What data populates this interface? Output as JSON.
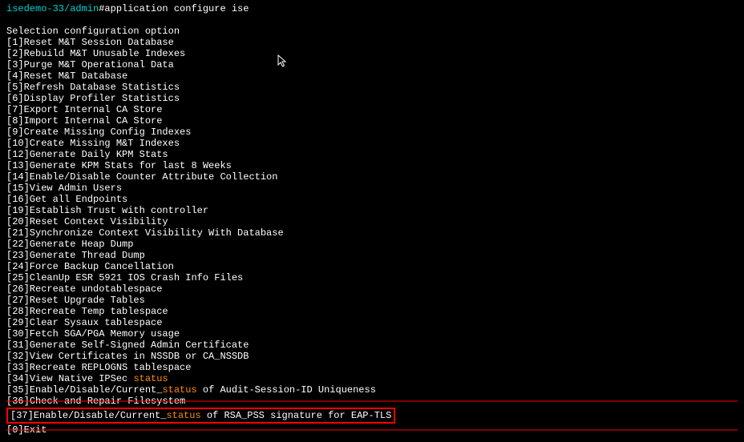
{
  "prompt": {
    "prefix": "isedemo-33/admin",
    "hash": "#",
    "command": "application configure ise"
  },
  "heading": "Selection configuration option",
  "options": [
    {
      "num": "1",
      "text": "Reset M&T Session Database"
    },
    {
      "num": "2",
      "text": "Rebuild M&T Unusable Indexes"
    },
    {
      "num": "3",
      "text": "Purge M&T Operational Data"
    },
    {
      "num": "4",
      "text": "Reset M&T Database"
    },
    {
      "num": "5",
      "text": "Refresh Database Statistics"
    },
    {
      "num": "6",
      "text": "Display Profiler Statistics"
    },
    {
      "num": "7",
      "text": "Export Internal CA Store"
    },
    {
      "num": "8",
      "text": "Import Internal CA Store"
    },
    {
      "num": "9",
      "text": "Create Missing Config Indexes"
    },
    {
      "num": "10",
      "text": "Create Missing M&T Indexes"
    },
    {
      "num": "12",
      "text": "Generate Daily KPM Stats"
    },
    {
      "num": "13",
      "text": "Generate KPM Stats for last 8 Weeks"
    },
    {
      "num": "14",
      "text": "Enable/Disable Counter Attribute Collection"
    },
    {
      "num": "15",
      "text": "View Admin Users"
    },
    {
      "num": "16",
      "text": "Get all Endpoints"
    },
    {
      "num": "19",
      "text": "Establish Trust with controller"
    },
    {
      "num": "20",
      "text": "Reset Context Visibility"
    },
    {
      "num": "21",
      "text": "Synchronize Context Visibility With Database"
    },
    {
      "num": "22",
      "text": "Generate Heap Dump"
    },
    {
      "num": "23",
      "text": "Generate Thread Dump"
    },
    {
      "num": "24",
      "text": "Force Backup Cancellation"
    },
    {
      "num": "25",
      "text": "CleanUp ESR 5921 IOS Crash Info Files"
    },
    {
      "num": "26",
      "text": "Recreate undotablespace"
    },
    {
      "num": "27",
      "text": "Reset Upgrade Tables"
    },
    {
      "num": "28",
      "text": "Recreate Temp tablespace"
    },
    {
      "num": "29",
      "text": "Clear Sysaux tablespace"
    },
    {
      "num": "30",
      "text": "Fetch SGA/PGA Memory usage"
    },
    {
      "num": "31",
      "text": "Generate Self-Signed Admin Certificate"
    },
    {
      "num": "32",
      "text": "View Certificates in NSSDB or CA_NSSDB"
    },
    {
      "num": "33",
      "text": "Recreate REPLOGNS tablespace"
    }
  ],
  "option34": {
    "num": "34",
    "pre": "View Native IPSec ",
    "status": "status"
  },
  "option35": {
    "num": "35",
    "pre": "Enable/Disable/Current_",
    "status": "status",
    "post": " of Audit-Session-ID Uniqueness"
  },
  "option36": {
    "num": "36",
    "text": "Check and Repair Filesystem"
  },
  "option37": {
    "num": "37",
    "pre": "Enable/Disable/Current_",
    "status": "status",
    "post": " of RSA_PSS signature for EAP-TLS"
  },
  "option0": {
    "num": "0",
    "text": "Exit"
  }
}
